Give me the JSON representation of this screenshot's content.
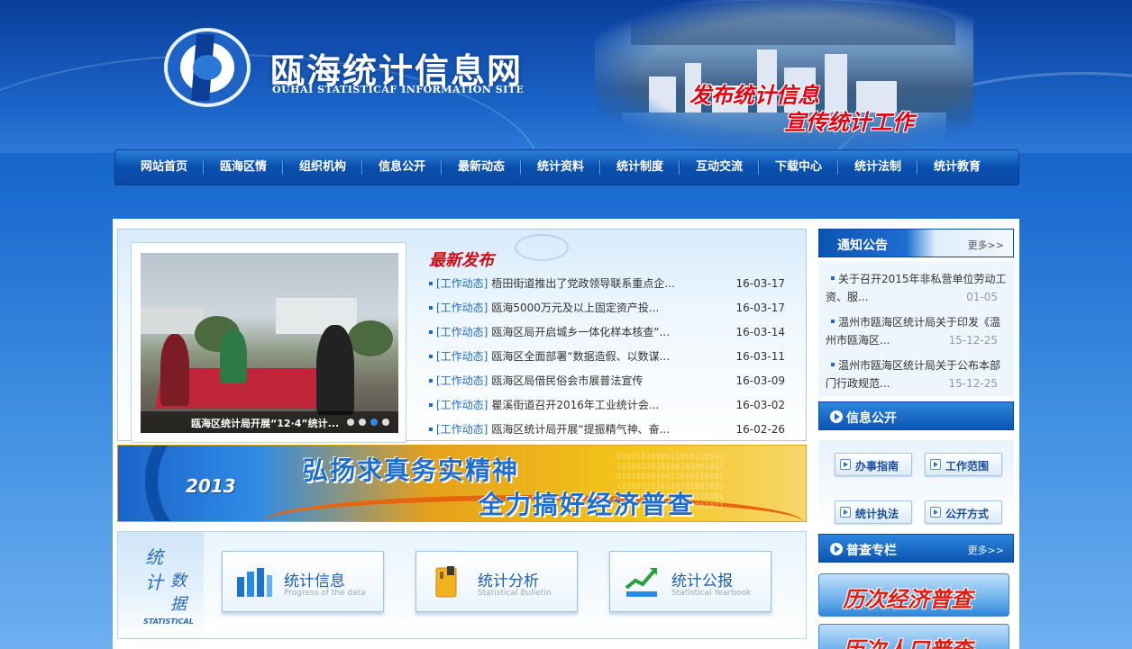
{
  "header": {
    "site_title": "瓯海统计信息网",
    "site_subtitle": "OUHAI STATISTICAF INFORMATION SITE",
    "slogan_line1": "发布统计信息",
    "slogan_line2": "宣传统计工作"
  },
  "nav": {
    "items": [
      "网站首页",
      "瓯海区情",
      "组织机构",
      "信息公开",
      "最新动态",
      "统计资料",
      "统计制度",
      "互动交流",
      "下载中心",
      "统计法制",
      "统计教育"
    ]
  },
  "slideshow": {
    "caption": "瓯海区统计局开展“12·4”统计...",
    "slide_count": 4,
    "active_index": 2
  },
  "latest": {
    "title": "最新发布",
    "items": [
      {
        "tag": "[工作动态]",
        "title": "梧田街道推出了党政领导联系重点企...",
        "date": "16-03-17"
      },
      {
        "tag": "[工作动态]",
        "title": "瓯海5000万元及以上固定资产投...",
        "date": "16-03-17"
      },
      {
        "tag": "[工作动态]",
        "title": "瓯海区局开启城乡一体化样本核查“...",
        "date": "16-03-14"
      },
      {
        "tag": "[工作动态]",
        "title": "瓯海区全面部署“数据造假、以数谋...",
        "date": "16-03-11"
      },
      {
        "tag": "[工作动态]",
        "title": "瓯海区局借民俗会市展普法宣传",
        "date": "16-03-09"
      },
      {
        "tag": "[工作动态]",
        "title": "瞿溪街道召开2016年工业统计会...",
        "date": "16-03-02"
      },
      {
        "tag": "[工作动态]",
        "title": "瓯海区统计局开展“提振精气神、奋...",
        "date": "16-02-26"
      }
    ]
  },
  "promo": {
    "year": "2013",
    "line1": "弘扬求真务实精神",
    "line2": "全力搞好经济普查"
  },
  "stats": {
    "label_chars": [
      "统",
      "计",
      "数",
      "据"
    ],
    "label_en": "STATISTICAL",
    "buttons": [
      {
        "title": "统计信息",
        "sub": "Progress of the data",
        "icon": "bar-chart-icon"
      },
      {
        "title": "统计分析",
        "sub": "Statistical Bulletin",
        "icon": "folder-icon"
      },
      {
        "title": "统计公报",
        "sub": "Statistical Yearbook",
        "icon": "trend-chart-icon"
      }
    ]
  },
  "sidebar": {
    "notice": {
      "title": "通知公告",
      "more": "更多>>",
      "items": [
        {
          "title": "关于召开2015年非私营单位劳动工资、服...",
          "date": "01-05"
        },
        {
          "title": "温州市瓯海区统计局关于印发《温州市瓯海区...",
          "date": "15-12-25"
        },
        {
          "title": "温州市瓯海区统计局关于公布本部门行政规范...",
          "date": "15-12-25"
        }
      ]
    },
    "info": {
      "title": "信息公开",
      "buttons": [
        "办事指南",
        "工作范围",
        "统计执法",
        "公开方式"
      ]
    },
    "census": {
      "title": "普查专栏",
      "more": "更多>>",
      "buttons": [
        "历次经济普查",
        "历次人口普查"
      ]
    }
  },
  "colors": {
    "brand_blue": "#0a4fae",
    "accent_red": "#e60012",
    "link_blue": "#1f6cc6"
  }
}
